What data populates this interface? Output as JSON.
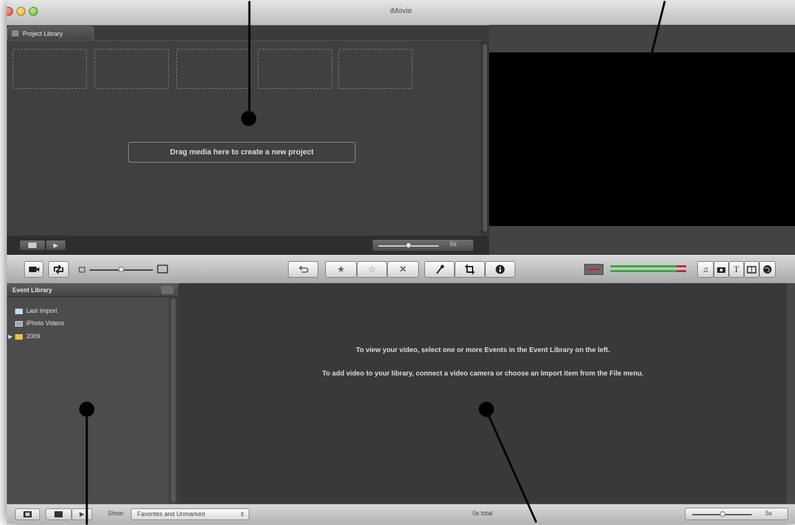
{
  "window": {
    "title": "iMovie"
  },
  "project_library": {
    "tab_label": "Project Library",
    "drag_prompt": "Drag media here to create a new project",
    "zoom_value": "5s"
  },
  "toolbar": {
    "buttons": [
      "camera-import",
      "swap-panels",
      "undo",
      "favorite-star",
      "unmark-star",
      "reject",
      "voiceover",
      "crop",
      "inspector",
      "music",
      "photos",
      "titles",
      "transitions",
      "maps"
    ]
  },
  "event_library": {
    "header": "Event Library",
    "items": [
      {
        "label": "Last Import",
        "icon": "import-icon"
      },
      {
        "label": "iPhoto Videos",
        "icon": "iphoto-icon"
      },
      {
        "label": "2009",
        "icon": "folder-icon"
      }
    ]
  },
  "event_browser": {
    "message_line_1": "To view your video, select one or more Events in the Event Library on the left.",
    "message_line_2": "To add video to your library, connect a video camera or choose an Import item from the File menu."
  },
  "status": {
    "show_label": "Show:",
    "filter_value": "Favorites and Unmarked",
    "total": "0s total",
    "zoom_value": "5s"
  },
  "colors": {
    "meter_green": "#2fae2f",
    "meter_red": "#c02a2a"
  }
}
